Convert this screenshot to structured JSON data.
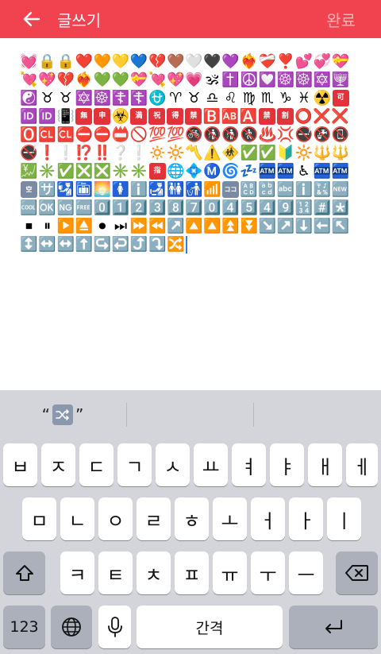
{
  "header": {
    "title": "글쓰기",
    "done_label": "완료",
    "accent_color": "#f0434f"
  },
  "editor": {
    "content": [
      "💓",
      "🔒",
      "🔒",
      "❤️",
      "🧡",
      "💛",
      "💙",
      "💔",
      "🤎",
      "🤍",
      "🖤",
      "💜",
      "❤️‍🔥",
      "❤️‍🩹",
      "❣️",
      "💕",
      "💞",
      "💝",
      "💘",
      "💖",
      "💔",
      "❤️‍🔥",
      "💚",
      "💚",
      "💝",
      "💘",
      "💖",
      "💗",
      "🕉",
      "✝️",
      "☮️",
      "💟",
      "☸️",
      "☸️",
      "🔯",
      "🕎",
      "☯️",
      "♉",
      "♉",
      "🔯",
      "☸️",
      "☦️",
      "☦️",
      "⛎",
      "♈",
      "♉",
      "♎",
      "♌",
      "♍",
      "♏",
      "♑",
      "♓",
      "☢️",
      "可",
      "🆔",
      "🆔",
      "📳",
      "無",
      "申",
      "☣️",
      "満",
      "祝",
      "得",
      "禁",
      "🅱️",
      "🆎",
      "🅰️",
      "禁",
      "割",
      "⭕",
      "❌",
      "❌",
      "🅾️",
      "🆑",
      "🆑",
      "⛔",
      "⛔",
      "📛",
      "🚫",
      "💯",
      "💯",
      "🚳",
      "🚯",
      "🚯",
      "🚷",
      "♨️",
      "💢",
      "🚭",
      "🚱",
      "📵",
      "🚭",
      "❗",
      "❕",
      "⁉️",
      "‼️",
      "❔",
      "❕",
      "🔅",
      "🔆",
      "〽️",
      "⚠️",
      "🚸",
      "✅",
      "✅",
      "🔰",
      "🔆",
      "🔱",
      "🔱",
      "💹",
      "✳️",
      "✅",
      "❎",
      "❎",
      "✳️",
      "✳️",
      "指",
      "🌐",
      "💠",
      "Ⓜ️",
      "🌀",
      "💤",
      "🏧",
      "🏧",
      "♿",
      "🏧",
      "🏧",
      "空",
      "🈂️",
      "🛂",
      "🛅",
      "🌅",
      "🚺",
      "ℹ️",
      "🛃",
      "🚻",
      "🚮",
      "📶",
      "ココ",
      "🔠",
      "🔡",
      "🔤",
      "ℹ️",
      "🔣",
      "🆕",
      "🆒",
      "🆗",
      "🆖",
      "🆓",
      "0️⃣",
      "1️⃣",
      "2️⃣",
      "3️⃣",
      "8️⃣",
      "7️⃣",
      "0️⃣",
      "4️⃣",
      "5️⃣",
      "4️⃣",
      "9️⃣",
      "🔢",
      "#️⃣",
      "*️⃣",
      "⏹",
      "⏸",
      "▶️",
      "⏏️",
      "⏺",
      "⏭",
      "⏩",
      "⏪",
      "↗️",
      "🔼",
      "🔼",
      "⏫",
      "⏬",
      "↘️",
      "↗️",
      "⬇️",
      "⬅️",
      "↖️",
      "↕️",
      "↔️",
      "↔️",
      "⬆️",
      "↪️",
      "↩️",
      "⤴️",
      "⤵️",
      "🔀"
    ]
  },
  "suggestions": {
    "items": [
      "“🔀”",
      "",
      ""
    ]
  },
  "keyboard": {
    "row1": [
      "ㅂ",
      "ㅈ",
      "ㄷ",
      "ㄱ",
      "ㅅ",
      "ㅛ",
      "ㅕ",
      "ㅑ",
      "ㅐ",
      "ㅔ"
    ],
    "row2": [
      "ㅁ",
      "ㄴ",
      "ㅇ",
      "ㄹ",
      "ㅎ",
      "ㅗ",
      "ㅓ",
      "ㅏ",
      "ㅣ"
    ],
    "row3": [
      "ㅋ",
      "ㅌ",
      "ㅊ",
      "ㅍ",
      "ㅠ",
      "ㅜ",
      "ㅡ"
    ],
    "numbers_label": "123",
    "space_label": "간격",
    "globe_icon": "globe-icon",
    "mic_icon": "microphone-icon",
    "shift_icon": "shift-icon",
    "delete_icon": "backspace-icon",
    "return_icon": "return-icon"
  }
}
